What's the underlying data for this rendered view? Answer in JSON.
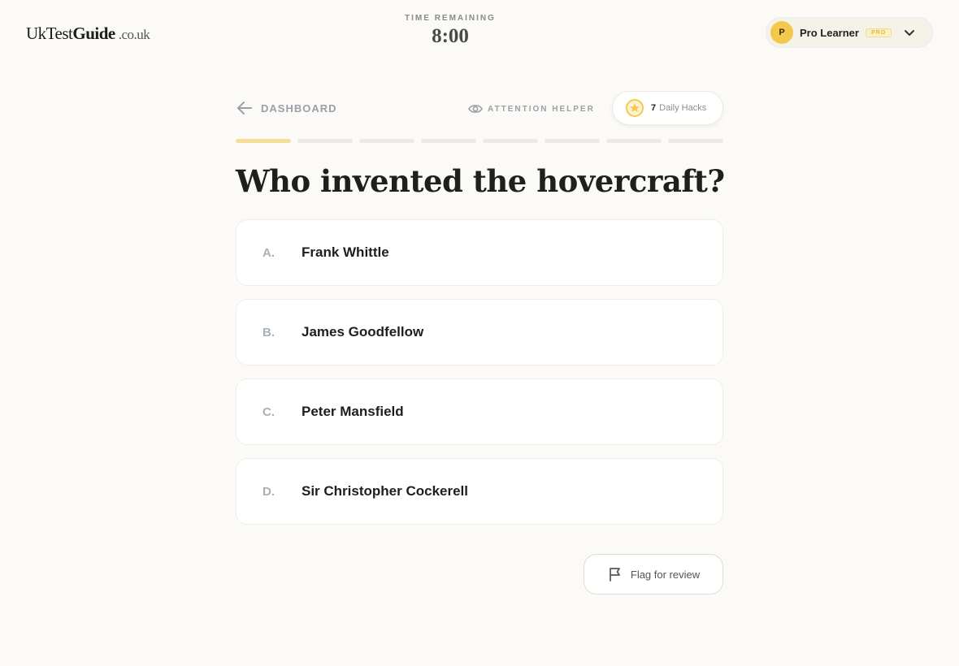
{
  "header": {
    "logo": {
      "part1": "Uk",
      "part2": "Test",
      "part3": "Guide",
      "tld": ".co.uk"
    },
    "timer": {
      "label": "TIME REMAINING",
      "value": "8:00"
    },
    "user": {
      "initial": "P",
      "name": "Pro Learner",
      "badge": "PRO"
    }
  },
  "nav": {
    "back_label": "DASHBOARD",
    "attention_label": "ATTENTION HELPER",
    "hacks_count": "7",
    "hacks_label": "Daily Hacks"
  },
  "progress": {
    "total_segments": 8,
    "current_index": 1
  },
  "question": {
    "text": "Who invented the hovercraft?"
  },
  "answers": [
    {
      "letter": "A.",
      "text": "Frank Whittle"
    },
    {
      "letter": "B.",
      "text": "James Goodfellow"
    },
    {
      "letter": "C.",
      "text": "Peter Mansfield"
    },
    {
      "letter": "D.",
      "text": "Sir Christopher Cockerell"
    }
  ],
  "flag_button": {
    "label": "Flag for review"
  },
  "colors": {
    "accent": "#f2c94c",
    "progress_active": "#f5dd96",
    "background": "#fbfaf6"
  }
}
